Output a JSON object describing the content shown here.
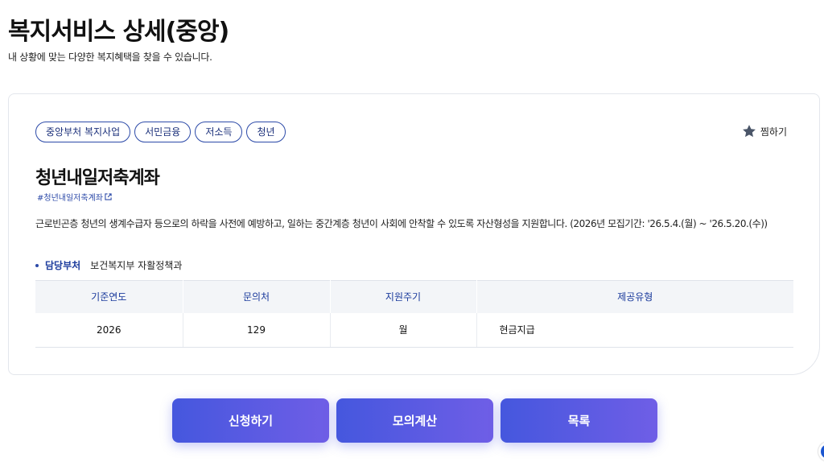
{
  "header": {
    "title": "복지서비스 상세(중앙)",
    "description": "내 상황에 맞는 다양한 복지혜택을 찾을 수 있습니다."
  },
  "service": {
    "tags": [
      "중앙부처 복지사업",
      "서민금융",
      "저소득",
      "청년"
    ],
    "bookmark_label": "찜하기",
    "title": "청년내일저축계좌",
    "hashtag": "#청년내일저축계좌",
    "summary": "근로빈곤층 청년의 생계수급자 등으로의 하락을 사전에 예방하고, 일하는 중간계층 청년이 사회에 안착할 수 있도록 자산형성을 지원합니다. (2026년 모집기간: '26.5.4.(월) ~ '26.5.20.(수))",
    "department": {
      "label": "담당부처",
      "value": "보건복지부 자활정책과"
    },
    "table": {
      "headers": [
        "기준연도",
        "문의처",
        "지원주기",
        "제공유형"
      ],
      "rows": [
        [
          "2026",
          "129",
          "월",
          "현금지급"
        ]
      ]
    }
  },
  "actions": {
    "apply": "신청하기",
    "simulate": "모의계산",
    "list": "목록"
  },
  "colors": {
    "accent": "#2c4aa8",
    "button_start": "#4557de",
    "button_end": "#6f5ee6"
  }
}
